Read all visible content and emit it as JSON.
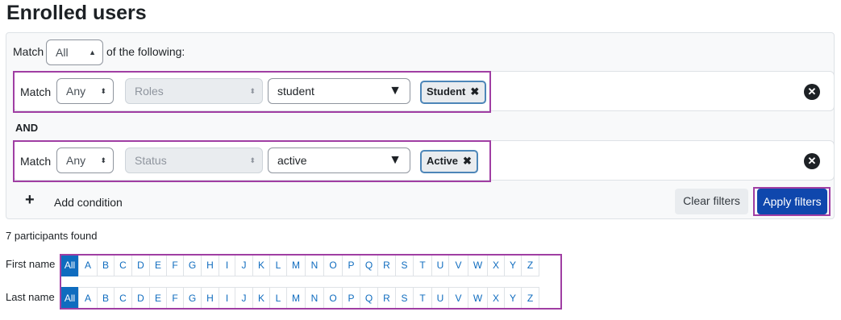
{
  "page": {
    "title": "Enrolled users"
  },
  "filters": {
    "match_label": "Match",
    "match_value": "All",
    "of_following": "of the following:",
    "conditions": [
      {
        "match_label": "Match",
        "match_value": "Any",
        "type": "Roles",
        "value": "student",
        "chip": "Student"
      },
      {
        "match_label": "Match",
        "match_value": "Any",
        "type": "Status",
        "value": "active",
        "chip": "Active"
      }
    ],
    "join_label": "AND",
    "add_condition": "Add condition",
    "clear_filters": "Clear filters",
    "apply_filters": "Apply filters"
  },
  "results": {
    "count_text": "7 participants found"
  },
  "initials": {
    "first_name_label": "First name",
    "last_name_label": "Last name",
    "all_label": "All",
    "letters": [
      "A",
      "B",
      "C",
      "D",
      "E",
      "F",
      "G",
      "H",
      "I",
      "J",
      "K",
      "L",
      "M",
      "N",
      "O",
      "P",
      "Q",
      "R",
      "S",
      "T",
      "U",
      "V",
      "W",
      "X",
      "Y",
      "Z"
    ]
  },
  "colors": {
    "highlight": "#a03ea3",
    "primary": "#0f47ad",
    "link": "#0f6cbf"
  }
}
